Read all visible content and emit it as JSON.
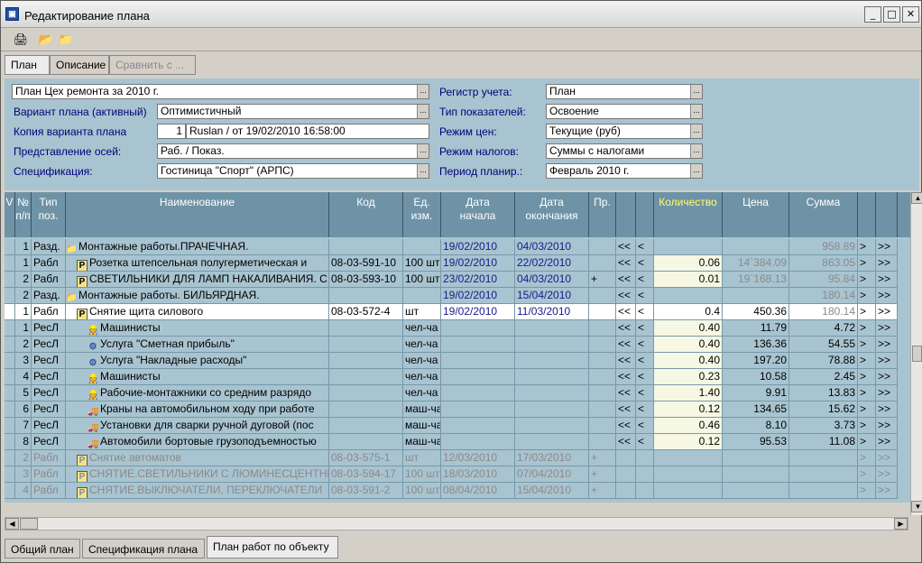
{
  "window": {
    "title": "Редактирование плана",
    "min": "_",
    "max": "□",
    "close": "✕",
    "app_icon": "plan-app-icon"
  },
  "toolbar": {
    "print": "🖨",
    "open": "📂",
    "open2": "📁"
  },
  "top_tabs": [
    "План",
    "Описание",
    "Сравнить с ..."
  ],
  "form": {
    "plan_value": "План Цех ремонта за 2010 г.",
    "variant_label": "Вариант плана (активный)",
    "variant_value": "Оптимистичный",
    "copy_label": "Копия варианта плана",
    "copy_num": "1",
    "copy_value": "Ruslan / от 19/02/2010 16:58:00",
    "axes_label": "Представление осей:",
    "axes_value": "Раб. / Показ.",
    "spec_label": "Спецификация:",
    "spec_value": "Гостиница \"Спорт\" (АРПС)",
    "register_label": "Регистр учета:",
    "register_value": "План",
    "indicators_label": "Тип показателей:",
    "indicators_value": "Освоение",
    "prices_label": "Режим цен:",
    "prices_value": "Текущие (руб)",
    "taxes_label": "Режим налогов:",
    "taxes_value": "Суммы с налогами",
    "period_label": "Период планир.:",
    "period_value": "Февраль 2010 г.",
    "dropdown": "..."
  },
  "grid": {
    "headers": [
      "V",
      "№\nп/п",
      "Тип\nпоз.",
      "Наименование",
      "Код",
      "Ед.\nизм.",
      "Дата\nначала",
      "Дата\nокончания",
      "Пр.",
      "",
      "",
      "Количество",
      "Цена",
      "Сумма",
      "",
      ""
    ],
    "rows": [
      {
        "v": "",
        "n": "1",
        "type": "Разд.",
        "icon": "📁",
        "name": "Монтажные работы.ПРАЧЕЧНАЯ.",
        "code": "",
        "unit": "",
        "start": "19/02/2010",
        "end": "04/03/2010",
        "pr": "",
        "a": "<<",
        "b": "<",
        "qty": "",
        "price": "",
        "sum": "958.89",
        "x": ">",
        "y": ">>"
      },
      {
        "v": "",
        "n": "1",
        "type": "Рабл",
        "icon": "P",
        "name": "Розетка штепсельная полугерметическая и",
        "code": "08-03-591-10",
        "unit": "100 шт",
        "start": "19/02/2010",
        "end": "22/02/2010",
        "pr": "",
        "a": "<<",
        "b": "<",
        "qty": "0.06",
        "price": "14`384.09",
        "sum": "863.05",
        "x": ">",
        "y": ">>"
      },
      {
        "v": "",
        "n": "2",
        "type": "Рабл",
        "icon": "P",
        "name": "СВЕТИЛЬНИКИ ДЛЯ ЛАМП НАКАЛИВАНИЯ. С",
        "code": "08-03-593-10",
        "unit": "100 шт",
        "start": "23/02/2010",
        "end": "04/03/2010",
        "pr": "+",
        "a": "<<",
        "b": "<",
        "qty": "0.01",
        "price": "19`168.13",
        "sum": "95.84",
        "x": ">",
        "y": ">>"
      },
      {
        "v": "",
        "n": "2",
        "type": "Разд.",
        "icon": "📁",
        "name": "Монтажные работы. БИЛЬЯРДНАЯ.",
        "code": "",
        "unit": "",
        "start": "19/02/2010",
        "end": "15/04/2010",
        "pr": "",
        "a": "<<",
        "b": "<",
        "qty": "",
        "price": "",
        "sum": "180.14",
        "x": ">",
        "y": ">>"
      },
      {
        "v": "",
        "n": "1",
        "type": "Рабл",
        "icon": "P",
        "name": "Снятие  щита силового",
        "code": "08-03-572-4",
        "unit": "шт",
        "start": "19/02/2010",
        "end": "11/03/2010",
        "pr": "",
        "a": "<<",
        "b": "<",
        "qty": "0.4",
        "price": "450.36",
        "sum": "180.14",
        "x": ">",
        "y": ">>"
      },
      {
        "v": "",
        "n": "1",
        "type": "РесЛ",
        "icon": "👷",
        "name": "Машинисты",
        "code": "",
        "unit": "чел-ча",
        "start": "",
        "end": "",
        "pr": "",
        "a": "<<",
        "b": "<",
        "qty": "0.40",
        "price": "11.79",
        "sum": "4.72",
        "x": ">",
        "y": ">>"
      },
      {
        "v": "",
        "n": "2",
        "type": "РесЛ",
        "icon": "⚙",
        "name": "Услуга \"Сметная прибыль\"",
        "code": "",
        "unit": "чел-ча",
        "start": "",
        "end": "",
        "pr": "",
        "a": "<<",
        "b": "<",
        "qty": "0.40",
        "price": "136.36",
        "sum": "54.55",
        "x": ">",
        "y": ">>"
      },
      {
        "v": "",
        "n": "3",
        "type": "РесЛ",
        "icon": "⚙",
        "name": "Услуга \"Накладные расходы\"",
        "code": "",
        "unit": "чел-ча",
        "start": "",
        "end": "",
        "pr": "",
        "a": "<<",
        "b": "<",
        "qty": "0.40",
        "price": "197.20",
        "sum": "78.88",
        "x": ">",
        "y": ">>"
      },
      {
        "v": "",
        "n": "4",
        "type": "РесЛ",
        "icon": "👷",
        "name": "Машинисты",
        "code": "",
        "unit": "чел-ча",
        "start": "",
        "end": "",
        "pr": "",
        "a": "<<",
        "b": "<",
        "qty": "0.23",
        "price": "10.58",
        "sum": "2.45",
        "x": ">",
        "y": ">>"
      },
      {
        "v": "",
        "n": "5",
        "type": "РесЛ",
        "icon": "👷",
        "name": "Рабочие-монтажники со средним разрядо",
        "code": "",
        "unit": "чел-ча",
        "start": "",
        "end": "",
        "pr": "",
        "a": "<<",
        "b": "<",
        "qty": "1.40",
        "price": "9.91",
        "sum": "13.83",
        "x": ">",
        "y": ">>"
      },
      {
        "v": "",
        "n": "6",
        "type": "РесЛ",
        "icon": "🚚",
        "name": "Краны на автомобильном ходу при работе",
        "code": "",
        "unit": "маш-ча",
        "start": "",
        "end": "",
        "pr": "",
        "a": "<<",
        "b": "<",
        "qty": "0.12",
        "price": "134.65",
        "sum": "15.62",
        "x": ">",
        "y": ">>"
      },
      {
        "v": "",
        "n": "7",
        "type": "РесЛ",
        "icon": "🚚",
        "name": "Установки для сварки ручной дуговой (пос",
        "code": "",
        "unit": "маш-ча",
        "start": "",
        "end": "",
        "pr": "",
        "a": "<<",
        "b": "<",
        "qty": "0.46",
        "price": "8.10",
        "sum": "3.73",
        "x": ">",
        "y": ">>"
      },
      {
        "v": "",
        "n": "8",
        "type": "РесЛ",
        "icon": "🚚",
        "name": "Автомобили бортовые грузоподъемностью",
        "code": "",
        "unit": "маш-ча",
        "start": "",
        "end": "",
        "pr": "",
        "a": "<<",
        "b": "<",
        "qty": "0.12",
        "price": "95.53",
        "sum": "11.08",
        "x": ">",
        "y": ">>"
      },
      {
        "v": "",
        "n": "2",
        "type": "Рабл",
        "icon": "P",
        "name": "Снятие автоматов",
        "code": "08-03-575-1",
        "unit": "шт",
        "start": "12/03/2010",
        "end": "17/03/2010",
        "pr": "+",
        "a": "",
        "b": "",
        "qty": "",
        "price": "",
        "sum": "",
        "x": ">",
        "y": ">>"
      },
      {
        "v": "",
        "n": "3",
        "type": "Рабл",
        "icon": "P",
        "name": "СНЯТИЕ.СВЕТИЛЬНИКИ С ЛЮМИНЕСЦЕНТНЫ",
        "code": "08-03-594-17",
        "unit": "100 шт",
        "start": "18/03/2010",
        "end": "07/04/2010",
        "pr": "+",
        "a": "",
        "b": "",
        "qty": "",
        "price": "",
        "sum": "",
        "x": ">",
        "y": ">>"
      },
      {
        "v": "",
        "n": "4",
        "type": "Рабл",
        "icon": "P",
        "name": "СНЯТИЕ.ВЫКЛЮЧАТЕЛИ, ПЕРЕКЛЮЧАТЕЛИ",
        "code": "08-03-591-2",
        "unit": "100 шт",
        "start": "08/04/2010",
        "end": "15/04/2010",
        "pr": "+",
        "a": "",
        "b": "",
        "qty": "",
        "price": "",
        "sum": "",
        "x": ">",
        "y": ">>"
      }
    ]
  },
  "bottom_tabs": [
    "Общий план",
    "Спецификация плана",
    "План работ по объекту"
  ]
}
